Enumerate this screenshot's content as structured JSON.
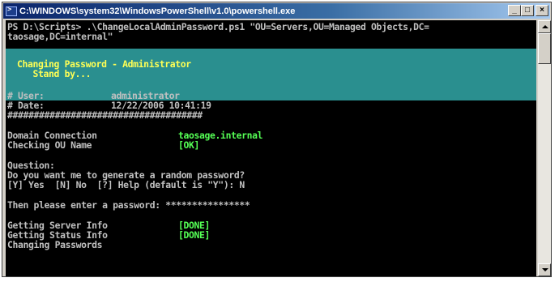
{
  "window": {
    "title": "C:\\WINDOWS\\system32\\WindowsPowerShell\\v1.0\\powershell.exe",
    "icon": "powershell-icon",
    "buttons": {
      "minimize": "_",
      "maximize": "□",
      "close": "×"
    }
  },
  "console": {
    "lines": [
      "PS D:\\Scripts> .\\ChangeLocalAdminPassword.ps1 \"OU=Servers,OU=Managed Objects,DC=",
      "taosage,DC=internal\""
    ],
    "banner": {
      "line1": "Changing Password - Administrator",
      "line2": "   Stand by..."
    },
    "info": {
      "user_label": "# User:",
      "user_value": "administrator",
      "date_label": "# Date:",
      "date_value": "12/22/2006 10:41:19",
      "hash_line": "#####################################"
    },
    "domain_label": "Domain Connection",
    "domain_value": "taosage.internal",
    "ou_label": "Checking OU Name",
    "ou_value": "[OK]",
    "question_label": "Question:",
    "question_text": "Do you want me to generate a random password?",
    "question_prompt": "[Y] Yes  [N] No  [?] Help (default is \"Y\"): N",
    "password_prompt": "Then please enter a password: ****************",
    "server_label": "Getting Server Info",
    "server_value": "[DONE]",
    "status_label": "Getting Status Info",
    "status_value": "[DONE]",
    "changing_text": "Changing Passwords"
  },
  "colors": {
    "console_bg": "#000000",
    "console_text": "#c0c0c0",
    "banner_bg": "#2a8f8f",
    "banner_text": "#ffff55",
    "status_green": "#55ff55",
    "titlebar": "#0a246a"
  }
}
